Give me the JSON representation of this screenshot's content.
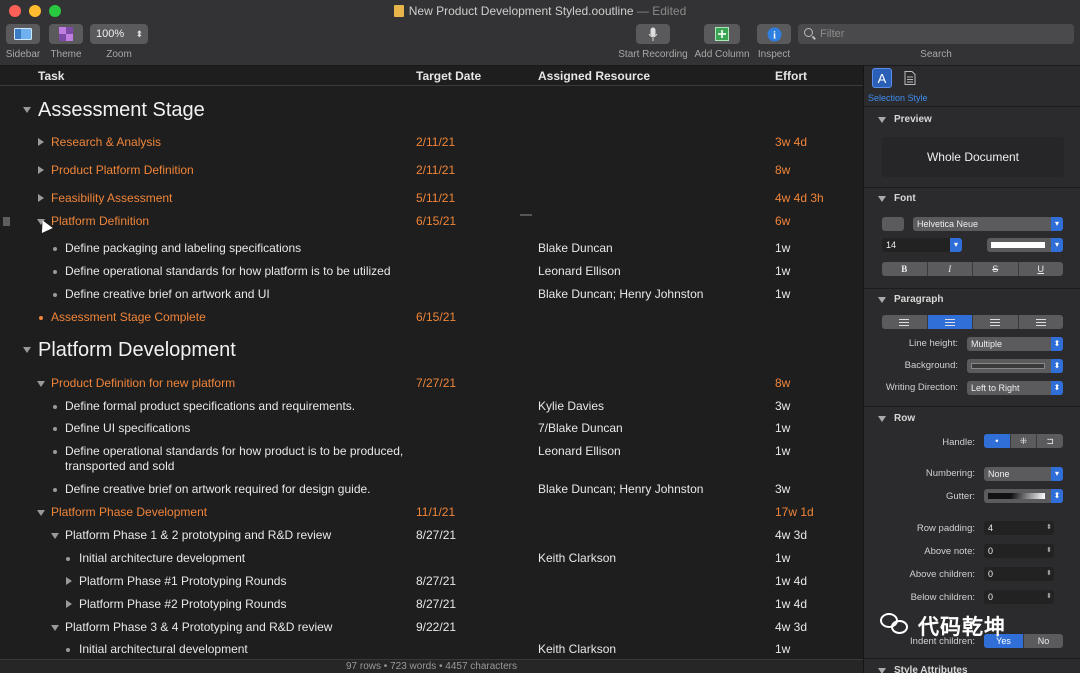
{
  "window": {
    "title": "New Product Development Styled.ooutline",
    "edited": "— Edited"
  },
  "toolbar": {
    "sidebar_label": "Sidebar",
    "theme_label": "Theme",
    "zoom_value": "100%",
    "zoom_label": "Zoom",
    "start_recording_label": "Start Recording",
    "add_column_label": "Add Column",
    "inspect_label": "Inspect",
    "filter_placeholder": "Filter",
    "search_label": "Search"
  },
  "columns": {
    "task": "Task",
    "target_date": "Target Date",
    "assigned_resource": "Assigned Resource",
    "effort": "Effort"
  },
  "rows": [
    {
      "task": "Assessment Stage",
      "date": "",
      "resource": "",
      "effort": "",
      "kind": "stage"
    },
    {
      "task": "Research & Analysis",
      "date": "2/11/21",
      "resource": "",
      "effort": "3w 4d",
      "kind": "group"
    },
    {
      "task": "Product Platform Definition",
      "date": "2/11/21",
      "resource": "",
      "effort": "8w",
      "kind": "group"
    },
    {
      "task": "Feasibility Assessment",
      "date": "5/11/21",
      "resource": "",
      "effort": "4w 4d 3h",
      "kind": "group"
    },
    {
      "task": "Platform Definition",
      "date": "6/15/21",
      "resource": "",
      "effort": "6w",
      "kind": "group-open"
    },
    {
      "task": "Define packaging and labeling specifications",
      "date": "",
      "resource": "Blake Duncan",
      "effort": "1w",
      "kind": "item"
    },
    {
      "task": "Define operational standards for how platform is to be utilized",
      "date": "",
      "resource": "Leonard Ellison",
      "effort": "1w",
      "kind": "item"
    },
    {
      "task": "Define creative brief on artwork and UI",
      "date": "",
      "resource": "Blake Duncan; Henry Johnston",
      "effort": "1w",
      "kind": "item"
    },
    {
      "task": "Assessment Stage Complete",
      "date": "6/15/21",
      "resource": "",
      "effort": "",
      "kind": "milestone"
    },
    {
      "task": "Platform Development",
      "date": "",
      "resource": "",
      "effort": "",
      "kind": "stage"
    },
    {
      "task": "Product Definition for new platform",
      "date": "7/27/21",
      "resource": "",
      "effort": "8w",
      "kind": "group-open"
    },
    {
      "task": "Define formal product specifications and requirements.",
      "date": "",
      "resource": "Kylie Davies",
      "effort": "3w",
      "kind": "item"
    },
    {
      "task": "Define UI specifications",
      "date": "",
      "resource": "7/Blake Duncan",
      "effort": "1w",
      "kind": "item"
    },
    {
      "task": "Define operational standards for how product is to be produced,",
      "task2": "transported and sold",
      "date": "",
      "resource": "Leonard Ellison",
      "effort": "1w",
      "kind": "item"
    },
    {
      "task": "Define creative brief on artwork required for design guide.",
      "date": "",
      "resource": "Blake Duncan; Henry Johnston",
      "effort": "3w",
      "kind": "item"
    },
    {
      "task": "Platform Phase Development",
      "date": "11/1/21",
      "resource": "",
      "effort": "17w 1d",
      "kind": "group-open"
    },
    {
      "task": "Platform Phase 1 & 2 prototyping and R&D review",
      "date": "8/27/21",
      "resource": "",
      "effort": "4w 3d",
      "kind": "sub-open"
    },
    {
      "task": "Initial architecture development",
      "date": "",
      "resource": "Keith Clarkson",
      "effort": "1w",
      "kind": "subitem"
    },
    {
      "task": "Platform Phase #1 Prototyping Rounds",
      "date": "8/27/21",
      "resource": "",
      "effort": "1w 4d",
      "kind": "subgroup"
    },
    {
      "task": "Platform Phase #2 Prototyping Rounds",
      "date": "8/27/21",
      "resource": "",
      "effort": "1w 4d",
      "kind": "subgroup"
    },
    {
      "task": "Platform Phase 3 & 4 Prototyping and R&D review",
      "date": "9/22/21",
      "resource": "",
      "effort": "4w 3d",
      "kind": "sub-open"
    },
    {
      "task": "Initial architectural development",
      "date": "",
      "resource": "Keith Clarkson",
      "effort": "1w",
      "kind": "subitem"
    }
  ],
  "statusbar": "97 rows • 723 words • 4457 characters",
  "inspector": {
    "caption": "Selection Style",
    "preview_title": "Preview",
    "preview_text": "Whole Document",
    "font_title": "Font",
    "font_family": "Helvetica Neue",
    "font_size": "14",
    "bold": "B",
    "italic": "I",
    "strike": "S",
    "underline": "U",
    "paragraph_title": "Paragraph",
    "line_height_label": "Line height:",
    "line_height_value": "Multiple",
    "background_label": "Background:",
    "writing_direction_label": "Writing Direction:",
    "writing_direction_value": "Left to Right",
    "row_title": "Row",
    "handle_label": "Handle:",
    "numbering_label": "Numbering:",
    "numbering_value": "None",
    "gutter_label": "Gutter:",
    "row_padding_label": "Row padding:",
    "row_padding_value": "4",
    "above_note_label": "Above note:",
    "above_note_value": "0",
    "above_children_label": "Above children:",
    "above_children_value": "0",
    "below_children_label": "Below children:",
    "below_children_value": "0",
    "indent_children_label": "Indent children:",
    "yes": "Yes",
    "no": "No",
    "style_attributes_title": "Style Attributes"
  },
  "watermark": "代码乾坤"
}
